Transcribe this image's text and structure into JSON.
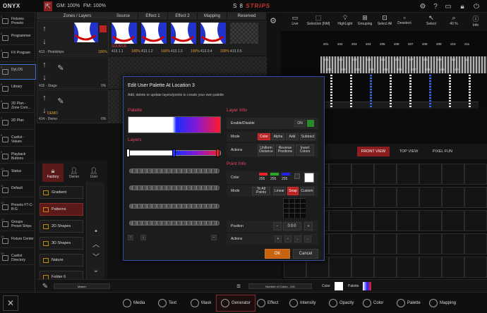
{
  "app": {
    "brand": "ONYX",
    "gm": "GM: 100%",
    "fm": "FM: 100%",
    "show_title": "S 8",
    "show_title_em": "STRIPS"
  },
  "toolbar": {
    "live": "Live",
    "selection": "Selection [NM]",
    "highlight": "HighLight",
    "grouping": "Grouping",
    "select_all": "Select All",
    "deselect": "Deselect",
    "select": "Select",
    "zoom": "40 %",
    "info": "Info"
  },
  "zones": {
    "header": "Zones / Layers",
    "rows": [
      {
        "label": "413 - Pixelstrips",
        "pct": "100%"
      },
      {
        "label": "415 - Stage",
        "pct": "0%"
      },
      {
        "label": "414 - Demo",
        "pct": "0%",
        "tag": "DEMO"
      }
    ]
  },
  "columns": {
    "source": "Source",
    "effect1": "Effect 1",
    "effect2": "Effect 2",
    "mapping": "Mapping",
    "reserved": "Reserved"
  },
  "cells": [
    {
      "id": "413.1.1",
      "pct": "100%",
      "tag": "SOURCE"
    },
    {
      "id": "413.1.2",
      "pct": "100%",
      "tag": "EFFECT"
    },
    {
      "id": "413.1.3",
      "pct": "100%",
      "tag": "EFFECT"
    },
    {
      "id": "413.0.4",
      "pct": "100%",
      "tag": "MAPPING"
    },
    {
      "id": "413.0.5",
      "pct": ""
    }
  ],
  "sidebar": [
    {
      "num": "1",
      "label": "Fixtures Presets"
    },
    {
      "num": "2",
      "label": "Programmer"
    },
    {
      "num": "3",
      "label": "FX Program"
    },
    {
      "num": "4",
      "label": "DyLOS"
    },
    {
      "num": "5",
      "label": "Library"
    },
    {
      "num": "6",
      "label": "2D Plan - Zone Com..."
    },
    {
      "num": "7",
      "label": "2D Plan"
    },
    {
      "num": "8",
      "label": "Cuelist - Values"
    },
    {
      "num": "9",
      "label": "Playback Buttons"
    },
    {
      "num": "10",
      "label": "Status"
    },
    {
      "num": "11",
      "label": "Default"
    },
    {
      "num": "12",
      "label": "Presets FT-C-B-G"
    },
    {
      "num": "13",
      "label": "Groups Preset Strips"
    },
    {
      "num": "14",
      "label": "Fixture Center"
    },
    {
      "num": "15",
      "label": "Cuelist Directory"
    }
  ],
  "library_tabs": {
    "factory": "Factory",
    "owner": "Owner",
    "user": "User"
  },
  "folders": [
    {
      "num": "1",
      "label": "Gradient"
    },
    {
      "num": "2",
      "label": "Patterns"
    },
    {
      "num": "3",
      "label": "2D Shapes"
    },
    {
      "num": "4",
      "label": "3D Shapes"
    },
    {
      "num": "5",
      "label": "Nature"
    },
    {
      "num": "6",
      "label": "Folder 6"
    }
  ],
  "dialog": {
    "title": "Edit User Palette At Location 3",
    "subtitle": "Add, delete or update layers/points to create your own palette",
    "palette_label": "Palette",
    "layers_label": "Layers",
    "layer_info": "Layer Info",
    "enable_label": "Enable/Disable",
    "enable_value": "ON",
    "mode_label": "Mode",
    "modes": [
      "Color",
      "Alpha",
      "Add",
      "Subtract"
    ],
    "actions_label": "Actions",
    "actions": [
      "Uniform Distance",
      "Reverse Positions",
      "Invert Colors"
    ],
    "point_info": "Point Info",
    "color_label": "Color",
    "rgb": [
      "255",
      "255",
      "255"
    ],
    "point_mode_label": "Mode",
    "point_modes": [
      "To All Points",
      "Linear",
      "Snap",
      "Custom"
    ],
    "position_label": "Position",
    "position_value": "000",
    "actions2_label": "Actions",
    "ok": "OK",
    "cancel": "Cancel"
  },
  "views": {
    "front": "FRONT VIEW",
    "top": "TOP VIEW",
    "pixel": "PIXEL FUN"
  },
  "stage_numbers": [
    "201",
    "202",
    "203",
    "204",
    "205",
    "206",
    "207",
    "208",
    "209",
    "210",
    "211",
    "101",
    "102",
    "103",
    "104",
    "105",
    "106",
    "107",
    "108",
    "109",
    "110",
    "111",
    "401",
    "402",
    "403",
    "404",
    "405",
    "406",
    "407",
    "408",
    "409",
    "410"
  ],
  "strip": {
    "master": "Master",
    "num_colors": "Number of Colors - 200",
    "color": "Color",
    "palette": "Palette"
  },
  "bottom_tabs": [
    "Media",
    "Text",
    "Mask",
    "Generator",
    "Effect",
    "Intensity",
    "Opacity",
    "Color",
    "Palette",
    "Mapping"
  ],
  "colors": {
    "accent": "#b22222",
    "dialog_border": "#2f4fa0",
    "ok": "#c8640f"
  }
}
